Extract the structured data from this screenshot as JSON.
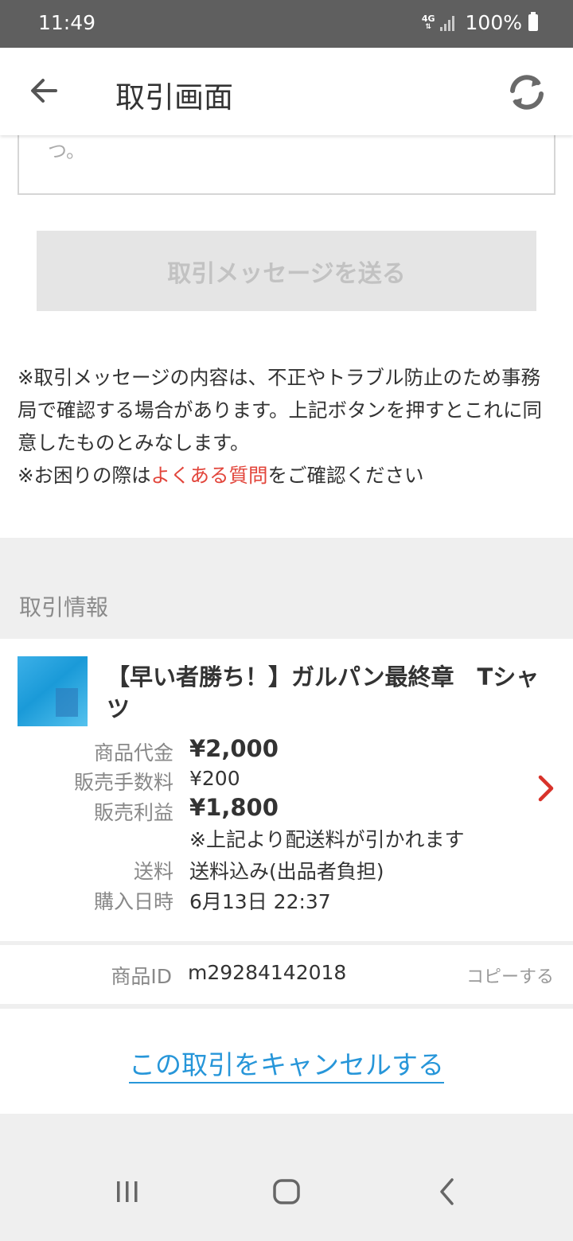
{
  "status_bar": {
    "time": "11:49",
    "network": "4G",
    "battery": "100%"
  },
  "header": {
    "title": "取引画面"
  },
  "message_box": {
    "tail_text": "つ。"
  },
  "send_button": {
    "label": "取引メッセージを送る"
  },
  "notice": {
    "line1": "※取引メッセージの内容は、不正やトラブル防止のため事務局で確認する場合があります。上記ボタンを押すとこれに同意したものとみなします。",
    "line2_prefix": "※お困りの際は",
    "line2_link": "よくある質問",
    "line2_suffix": "をご確認ください"
  },
  "section": {
    "label": "取引情報"
  },
  "item": {
    "title": "【早い者勝ち！】ガルパン最終章　Tシャツ",
    "rows": [
      {
        "label": "商品代金",
        "value": "¥2,000"
      },
      {
        "label": "販売手数料",
        "value": "¥200"
      },
      {
        "label": "販売利益",
        "value": "¥1,800"
      },
      {
        "label": "",
        "value": "※上記より配送料が引かれます"
      },
      {
        "label": "送料",
        "value": "送料込み(出品者負担)"
      },
      {
        "label": "購入日時",
        "value": "6月13日 22:37"
      }
    ]
  },
  "item_id": {
    "label": "商品ID",
    "value": "m29284142018",
    "copy_label": "コピーする"
  },
  "cancel": {
    "label": "この取引をキャンセルする"
  },
  "colors": {
    "link_red": "#e2453b",
    "link_blue": "#2796d9",
    "status_bar": "#5f5f5f"
  }
}
